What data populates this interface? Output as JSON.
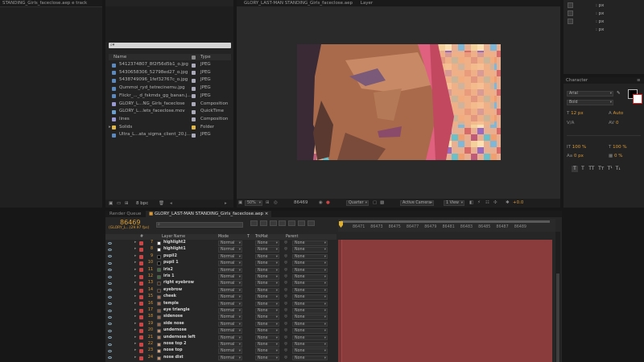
{
  "left_panel": {
    "title": "STANDING_Girls_faceclose.aep e track"
  },
  "project": {
    "title": "GLORY_LAST-MAN STANDING_Girls_faceclose.aep",
    "search_placeholder": "",
    "col_name": "Name",
    "col_type": "Type",
    "items": [
      {
        "name": "5412374807_8f2f56d5b1_o.jpg",
        "type": "JPEG",
        "kind": "image",
        "color": "#5a8abf"
      },
      {
        "name": "5430658306_52798ed27_o.jpg",
        "type": "JPEG",
        "kind": "image",
        "color": "#5a8abf"
      },
      {
        "name": "5438749096_1fef32767c_o.jpg",
        "type": "JPEG",
        "kind": "image",
        "color": "#5a8abf"
      },
      {
        "name": "Qummoi_ryd_tetrecinemu.jpg",
        "type": "JPEG",
        "kind": "image",
        "color": "#5a8abf"
      },
      {
        "name": "Flickr_..._d_fskmds_gg_banan.jpg",
        "type": "JPEG",
        "kind": "image",
        "color": "#5a8abf"
      },
      {
        "name": "GLORY_L...NG_Girls_faceclose",
        "type": "Composition",
        "kind": "comp",
        "color": "#9a9ad6"
      },
      {
        "name": "GLORY_L...lets_faceclose.mov",
        "type": "QuickTime",
        "kind": "video",
        "color": "#6aa0cf"
      },
      {
        "name": "lines",
        "type": "Composition",
        "kind": "comp",
        "color": "#9a9ad6"
      },
      {
        "name": "Solids",
        "type": "Folder",
        "kind": "folder",
        "color": "#e0b84a"
      },
      {
        "name": "Ultra_L...ata_sigma_client_20.JPG",
        "type": "JPEG",
        "kind": "image",
        "color": "#5a8abf"
      }
    ],
    "bpc": "8 bpc"
  },
  "viewer": {
    "tab": "Layer",
    "zoom": "50%",
    "timecode": "86469",
    "resolution": "Quarter",
    "camera": "Active Camera",
    "views": "1 View",
    "exposure": "+0.0"
  },
  "info_panel": {
    "labels": [
      "px",
      "px",
      "px",
      "px"
    ],
    "values": [
      "",
      "",
      "",
      ""
    ]
  },
  "character": {
    "title": "Character",
    "font": "Arial",
    "style": "Bold",
    "size": "12 px",
    "leading": "Auto",
    "kerning": "",
    "tracking": "0",
    "vscale": "100 %",
    "hscale": "100 %",
    "baseline": "0 px",
    "tsume": "0 %"
  },
  "timeline": {
    "tabs": [
      "Render Queue",
      "GLORY_LAST-MAN STANDING_Girls_faceclose.aep"
    ],
    "timecode": "86469",
    "timecode_sub": "(GLORY_L...(29.97 fps)",
    "search_placeholder": "",
    "col_num": "#",
    "col_name": "Layer Name",
    "col_mode": "Mode",
    "col_t": "T",
    "col_trkmat": "TrkMat",
    "col_parent": "Parent",
    "ruler": [
      "86471",
      "86473",
      "86475",
      "86477",
      "86479",
      "86481",
      "86483",
      "86485",
      "86487",
      "86489"
    ],
    "layers": [
      {
        "num": "7",
        "name": "highlight2",
        "color": "#ffffff",
        "mode": "Normal",
        "trk": "None",
        "parent": "None"
      },
      {
        "num": "8",
        "name": "highlight1",
        "color": "#ffffff",
        "mode": "Normal",
        "trk": "None",
        "parent": "None"
      },
      {
        "num": "9",
        "name": "pupil2",
        "color": "#000000",
        "mode": "Normal",
        "trk": "None",
        "parent": "None"
      },
      {
        "num": "10",
        "name": "pupil 1",
        "color": "#000000",
        "mode": "Normal",
        "trk": "None",
        "parent": "None"
      },
      {
        "num": "11",
        "name": "iris2",
        "color": "#3d6a3d",
        "mode": "Normal",
        "trk": "None",
        "parent": "None"
      },
      {
        "num": "12",
        "name": "iris 1",
        "color": "#3d6a3d",
        "mode": "Normal",
        "trk": "None",
        "parent": "None"
      },
      {
        "num": "13",
        "name": "right eyebrow",
        "color": "#3a2416",
        "mode": "Normal",
        "trk": "None",
        "parent": "None"
      },
      {
        "num": "14",
        "name": "eyebrow",
        "color": "#3a2416",
        "mode": "Normal",
        "trk": "None",
        "parent": "None"
      },
      {
        "num": "15",
        "name": "cheek",
        "color": "#a86a4e",
        "mode": "Normal",
        "trk": "None",
        "parent": "None"
      },
      {
        "num": "16",
        "name": "temple",
        "color": "#a86a4e",
        "mode": "Normal",
        "trk": "None",
        "parent": "None"
      },
      {
        "num": "17",
        "name": "eye triangle",
        "color": "#8a5a3e",
        "mode": "Normal",
        "trk": "None",
        "parent": "None"
      },
      {
        "num": "18",
        "name": "sidenose",
        "color": "#9a6448",
        "mode": "Normal",
        "trk": "None",
        "parent": "None"
      },
      {
        "num": "19",
        "name": "side nose",
        "color": "#9a6448",
        "mode": "Normal",
        "trk": "None",
        "parent": "None"
      },
      {
        "num": "20",
        "name": "undernose",
        "color": "#c28a66",
        "mode": "Normal",
        "trk": "None",
        "parent": "None"
      },
      {
        "num": "21",
        "name": "undernose left",
        "color": "#b07a58",
        "mode": "Normal",
        "trk": "None",
        "parent": "None"
      },
      {
        "num": "22",
        "name": "nose top 2",
        "color": "#c8926c",
        "mode": "Normal",
        "trk": "None",
        "parent": "None"
      },
      {
        "num": "23",
        "name": "nose top",
        "color": "#d4a07a",
        "mode": "Normal",
        "trk": "None",
        "parent": "None"
      },
      {
        "num": "24",
        "name": "nose dist",
        "color": "#c89068",
        "mode": "Normal",
        "trk": "None",
        "parent": "None"
      }
    ]
  }
}
